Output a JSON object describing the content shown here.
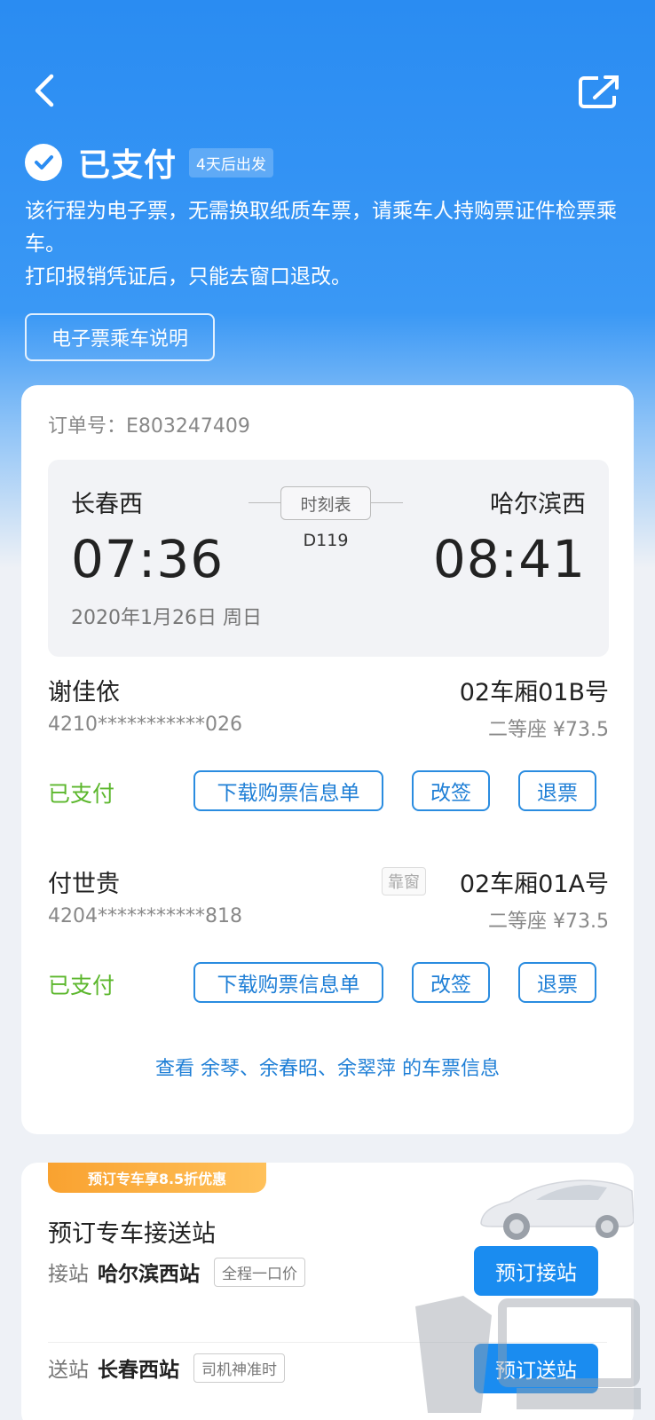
{
  "header": {
    "status_title": "已支付",
    "status_badge": "4天后出发",
    "description_line1": "该行程为电子票，无需换取纸质车票，请乘车人持购票证件检票乘车。",
    "description_line2": "打印报销凭证后，只能去窗口退改。",
    "guide_button": "电子票乘车说明"
  },
  "order": {
    "order_number": "订单号：E803247409",
    "from_station": "长春西",
    "from_time": "07:36",
    "to_station": "哈尔滨西",
    "to_time": "08:41",
    "timetable_button": "时刻表",
    "train_number": "D119",
    "date": "2020年1月26日 周日"
  },
  "passengers": [
    {
      "name": "谢佳依",
      "id_number": "4210***********026",
      "seat": "02车厢01B号",
      "price": "二等座 ¥73.5",
      "tag": "",
      "status": "已支付",
      "download_button": "下载购票信息单",
      "change_button": "改签",
      "refund_button": "退票"
    },
    {
      "name": "付世贵",
      "id_number": "4204***********818",
      "seat": "02车厢01A号",
      "price": "二等座 ¥73.5",
      "tag": "靠窗",
      "status": "已支付",
      "download_button": "下载购票信息单",
      "change_button": "改签",
      "refund_button": "退票"
    }
  ],
  "view_others_link": "查看 余琴、余春昭、余翠萍 的车票信息",
  "car_service": {
    "promo": "预订专车享8.5折优惠",
    "title": "预订专车接送站",
    "pickup": {
      "kind": "接站",
      "station": "哈尔滨西站",
      "tag": "全程一口价",
      "button": "预订接站"
    },
    "dropoff": {
      "kind": "送站",
      "station": "长春西站",
      "tag": "司机神准时",
      "button": "预订送站"
    }
  },
  "colors": {
    "primary_blue": "#2a8cf2",
    "paid_green": "#5cb72d",
    "promo_orange": "#f9a230"
  },
  "icons": {
    "back": "chevron-left-icon",
    "share": "share-icon",
    "status": "check-circle-icon"
  }
}
